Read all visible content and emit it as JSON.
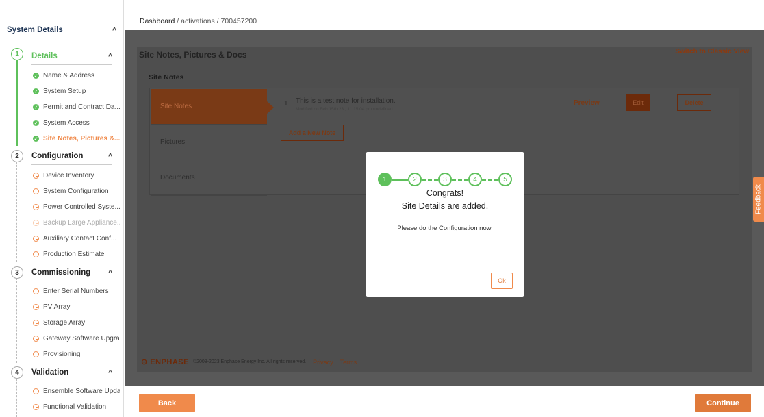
{
  "breadcrumb": {
    "home": "Dashboard",
    "sep": "/",
    "section": "activations",
    "id": "700457200"
  },
  "sidebar": {
    "header": "System Details",
    "sections": [
      {
        "num": "1",
        "label": "Details",
        "items": [
          "Name & Address",
          "System Setup",
          "Permit and Contract Da...",
          "System Access",
          "Site Notes, Pictures &..."
        ]
      },
      {
        "num": "2",
        "label": "Configuration",
        "items": [
          "Device Inventory",
          "System Configuration",
          "Power Controlled Syste...",
          "Backup Large Appliance...",
          "Auxiliary Contact Conf...",
          "Production Estimate"
        ]
      },
      {
        "num": "3",
        "label": "Commissioning",
        "items": [
          "Enter Serial Numbers",
          "PV Array",
          "Storage Array",
          "Gateway Software Upgra...",
          "Provisioning"
        ]
      },
      {
        "num": "4",
        "label": "Validation",
        "items": [
          "Ensemble Software Upda...",
          "Functional Validation"
        ]
      }
    ]
  },
  "page": {
    "title": "Site Notes, Pictures & Docs",
    "classic_link": "Switch to Classic View",
    "notes_header": "Site Notes"
  },
  "tabs": [
    "Site Notes",
    "Pictures",
    "Documents"
  ],
  "note": {
    "num": "1",
    "text": "This is a test note for installation.",
    "meta": "Modified on Feb 15th 23 , 11:15:04 pm undefined",
    "preview": "Preview",
    "edit": "Edit",
    "delete": "Delete"
  },
  "add_note": "Add a New Note",
  "footer": {
    "logo": "ENPHASE",
    "copyright": "©2008-2023 Enphase Energy Inc. All rights reserved.",
    "privacy": "Privacy",
    "terms": "Terms"
  },
  "feedback": "Feedback",
  "buttons": {
    "back": "Back",
    "continue": "Continue"
  },
  "modal": {
    "steps": [
      "1",
      "2",
      "3",
      "4",
      "5"
    ],
    "congrats": "Congrats!",
    "added": "Site Details are added.",
    "message": "Please do the Configuration now.",
    "ok": "Ok"
  },
  "colors": {
    "accent": "#f08a4b",
    "success": "#5ec05b",
    "overlay": "#595959"
  }
}
